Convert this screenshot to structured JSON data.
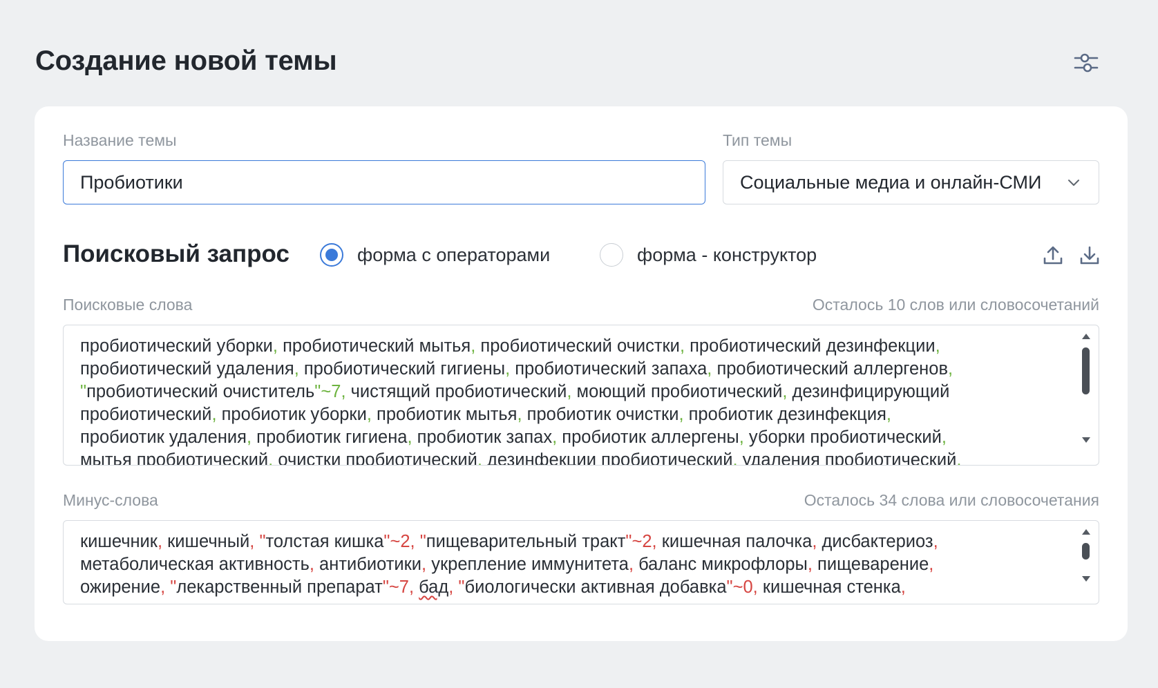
{
  "header": {
    "title": "Создание новой темы",
    "settings_icon": "sliders-icon"
  },
  "form": {
    "name_label": "Название темы",
    "name_value": "Пробиотики",
    "type_label": "Тип темы",
    "type_value": "Социальные медиа и онлайн-СМИ",
    "accent_color": "#3b7ad9"
  },
  "query": {
    "title": "Поисковый запрос",
    "mode_operators_label": "форма с операторами",
    "mode_builder_label": "форма - конструктор",
    "selected_mode": "operators",
    "upload_icon": "upload-icon",
    "download_icon": "download-icon"
  },
  "search_words": {
    "label": "Поисковые слова",
    "counter": "Осталось 10 слов или словосочетаний",
    "separator_color": "#6db33f",
    "lines": [
      [
        {
          "t": "пробиотический уборки"
        },
        {
          "t": ",",
          "c": "g"
        },
        {
          "t": " пробиотический мытья"
        },
        {
          "t": ",",
          "c": "g"
        },
        {
          "t": " пробиотический очистки"
        },
        {
          "t": ",",
          "c": "g"
        },
        {
          "t": " пробиотический дезинфекции"
        },
        {
          "t": ",",
          "c": "g"
        }
      ],
      [
        {
          "t": "пробиотический удаления"
        },
        {
          "t": ",",
          "c": "g"
        },
        {
          "t": " пробиотический гигиены"
        },
        {
          "t": ",",
          "c": "g"
        },
        {
          "t": " пробиотический запаха"
        },
        {
          "t": ",",
          "c": "g"
        },
        {
          "t": " пробиотический аллергенов"
        },
        {
          "t": ",",
          "c": "g"
        }
      ],
      [
        {
          "t": "\"",
          "c": "g"
        },
        {
          "t": "пробиотический очиститель"
        },
        {
          "t": "\"~7",
          "c": "g"
        },
        {
          "t": ",",
          "c": "g"
        },
        {
          "t": " чистящий пробиотический"
        },
        {
          "t": ",",
          "c": "g"
        },
        {
          "t": " моющий пробиотический"
        },
        {
          "t": ",",
          "c": "g"
        },
        {
          "t": " дезинфицирующий"
        }
      ],
      [
        {
          "t": "пробиотический"
        },
        {
          "t": ",",
          "c": "g"
        },
        {
          "t": " пробиотик уборки"
        },
        {
          "t": ",",
          "c": "g"
        },
        {
          "t": " пробиотик мытья"
        },
        {
          "t": ",",
          "c": "g"
        },
        {
          "t": " пробиотик очистки"
        },
        {
          "t": ",",
          "c": "g"
        },
        {
          "t": " пробиотик дезинфекция"
        },
        {
          "t": ",",
          "c": "g"
        }
      ],
      [
        {
          "t": "пробиотик удаления"
        },
        {
          "t": ",",
          "c": "g"
        },
        {
          "t": " пробиотик гигиена"
        },
        {
          "t": ",",
          "c": "g"
        },
        {
          "t": " пробиотик запах"
        },
        {
          "t": ",",
          "c": "g"
        },
        {
          "t": " пробиотик аллергены"
        },
        {
          "t": ",",
          "c": "g"
        },
        {
          "t": " уборки пробиотический"
        },
        {
          "t": ",",
          "c": "g"
        }
      ],
      [
        {
          "t": "мытья пробиотический"
        },
        {
          "t": ",",
          "c": "g"
        },
        {
          "t": " очистки пробиотический"
        },
        {
          "t": ",",
          "c": "g"
        },
        {
          "t": " дезинфекции пробиотический"
        },
        {
          "t": ",",
          "c": "g"
        },
        {
          "t": " удаления пробиотический"
        },
        {
          "t": ",",
          "c": "g"
        }
      ]
    ]
  },
  "minus_words": {
    "label": "Минус-слова",
    "counter": "Осталось 34 слова или словосочетания",
    "separator_color": "#d64541",
    "lines": [
      [
        {
          "t": "кишечник"
        },
        {
          "t": ",",
          "c": "r"
        },
        {
          "t": " кишечный"
        },
        {
          "t": ",",
          "c": "r"
        },
        {
          "t": " "
        },
        {
          "t": "\"",
          "c": "r"
        },
        {
          "t": "толстая кишка"
        },
        {
          "t": "\"~2",
          "c": "r"
        },
        {
          "t": ",",
          "c": "r"
        },
        {
          "t": " "
        },
        {
          "t": "\"",
          "c": "r"
        },
        {
          "t": "пищеварительный тракт"
        },
        {
          "t": "\"~2",
          "c": "r"
        },
        {
          "t": ",",
          "c": "r"
        },
        {
          "t": " кишечная палочка"
        },
        {
          "t": ",",
          "c": "r"
        },
        {
          "t": " дисбактериоз"
        },
        {
          "t": ",",
          "c": "r"
        }
      ],
      [
        {
          "t": "метаболическая активность"
        },
        {
          "t": ",",
          "c": "r"
        },
        {
          "t": " антибиотики"
        },
        {
          "t": ",",
          "c": "r"
        },
        {
          "t": " укрепление иммунитета"
        },
        {
          "t": ",",
          "c": "r"
        },
        {
          "t": " баланс микрофлоры"
        },
        {
          "t": ",",
          "c": "r"
        },
        {
          "t": " пищеварение"
        },
        {
          "t": ",",
          "c": "r"
        }
      ],
      [
        {
          "t": "ожирение"
        },
        {
          "t": ",",
          "c": "r"
        },
        {
          "t": " "
        },
        {
          "t": "\"",
          "c": "r"
        },
        {
          "t": "лекарственный препарат"
        },
        {
          "t": "\"~7",
          "c": "r"
        },
        {
          "t": ",",
          "c": "r"
        },
        {
          "t": " "
        },
        {
          "t": "бад",
          "c": "s"
        },
        {
          "t": ",",
          "c": "r"
        },
        {
          "t": " "
        },
        {
          "t": "\"",
          "c": "r"
        },
        {
          "t": "биологически активная добавка"
        },
        {
          "t": "\"~0",
          "c": "r"
        },
        {
          "t": ",",
          "c": "r"
        },
        {
          "t": " кишечная стенка"
        },
        {
          "t": ",",
          "c": "r"
        }
      ]
    ]
  }
}
